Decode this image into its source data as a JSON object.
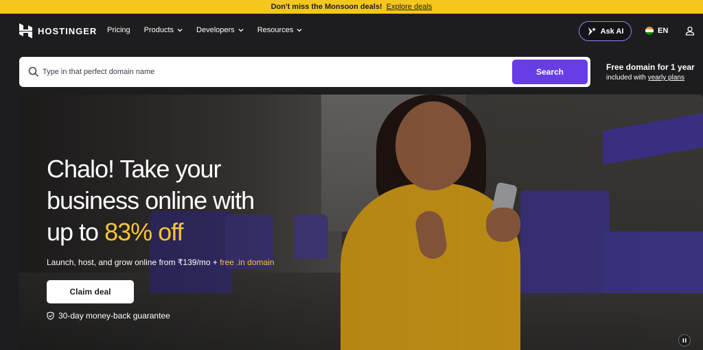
{
  "promo": {
    "text": "Don't miss the Monsoon deals!",
    "link": "Explore deals"
  },
  "nav": {
    "logo": "HOSTINGER",
    "links": [
      {
        "label": "Pricing",
        "dropdown": false
      },
      {
        "label": "Products",
        "dropdown": true
      },
      {
        "label": "Developers",
        "dropdown": true
      },
      {
        "label": "Resources",
        "dropdown": true
      }
    ],
    "ask_ai": "Ask AI",
    "language": "EN"
  },
  "search": {
    "placeholder": "Type in that perfect domain name",
    "button": "Search",
    "offer_title": "Free domain for 1 year",
    "offer_sub_prefix": "included with ",
    "offer_sub_link": "yearly plans"
  },
  "hero": {
    "title_line1": "Chalo! Take your",
    "title_line2": "business online with",
    "title_prefix": "up to ",
    "title_highlight": "83% off",
    "subtitle_prefix": "Launch, host, and grow online from ₹139/mo + ",
    "subtitle_highlight": "free .in domain",
    "cta": "Claim deal",
    "guarantee": "30-day money-back guarantee"
  },
  "colors": {
    "accent": "#673de6",
    "promo": "#f5c61e",
    "highlight": "#fcc439",
    "background": "#1d1d1f"
  }
}
